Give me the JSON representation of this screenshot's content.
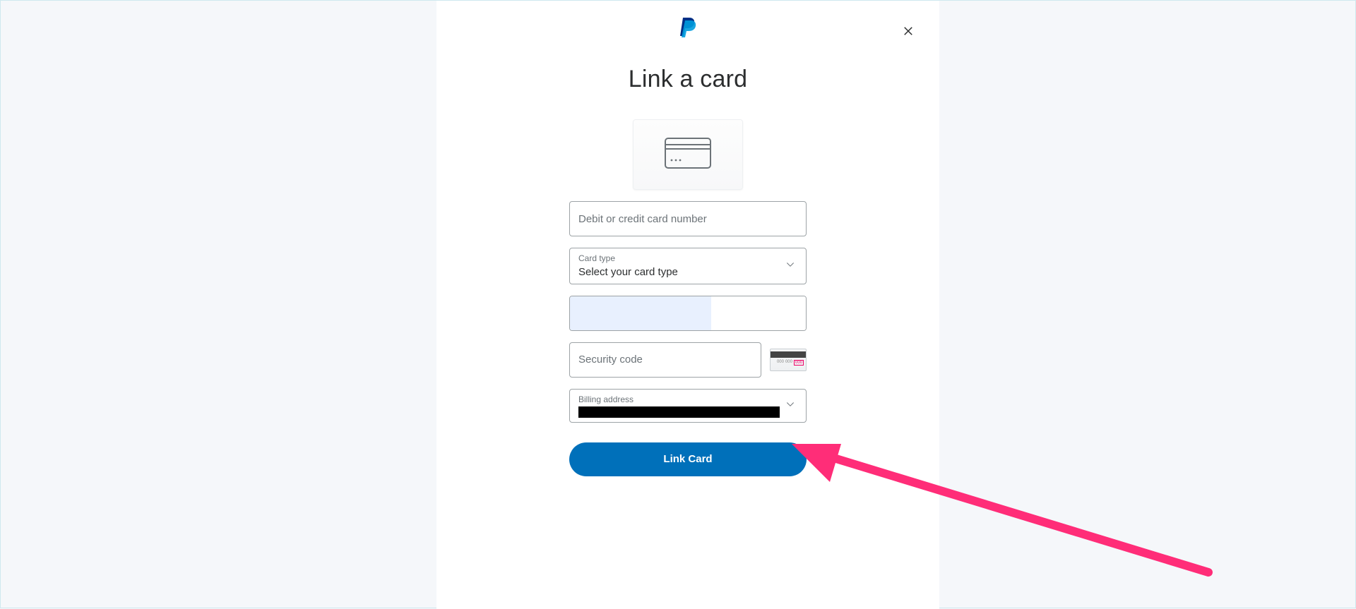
{
  "page": {
    "title": "Link a card"
  },
  "icons": {
    "close": "close",
    "paypal": "paypal-logo",
    "generic_card": "generic-card",
    "chevron_down": "chevron-down",
    "cvv_hint": "cvv-location-hint"
  },
  "form": {
    "card_number": {
      "placeholder": "Debit or credit card number",
      "value": ""
    },
    "card_type": {
      "label": "Card type",
      "value": "Select your card type"
    },
    "expiry": {
      "value": ""
    },
    "security": {
      "placeholder": "Security code",
      "value": ""
    },
    "billing": {
      "label": "Billing address",
      "value_redacted": true
    }
  },
  "actions": {
    "submit_label": "Link Card"
  },
  "colors": {
    "accent": "#0070ba",
    "page_bg": "#f5f7fa",
    "panel_bg": "#ffffff",
    "border": "#9da3a6",
    "annotation": "#ff2d78"
  },
  "annotation": {
    "arrow_points_to": "submit-button"
  }
}
